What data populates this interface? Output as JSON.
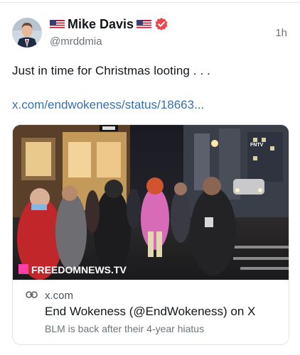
{
  "post": {
    "display_name": "Mike Davis",
    "handle": "@mrddmia",
    "time": "1h",
    "text": "Just in time for Christmas looting . . .",
    "link": "x.com/endwokeness/status/18663..."
  },
  "card": {
    "image_watermark": "FREEDOMNEWS.TV",
    "image_corner_tag": "FNTV",
    "domain": "x.com",
    "title": "End Wokeness (@EndWokeness) on X",
    "description": "BLM is back after their 4-year hiatus"
  },
  "colors": {
    "link": "#3b6fa8",
    "verified_badge": "#e8494f",
    "watermark_accent": "#ff3fa8"
  },
  "icons": [
    "us-flag-icon",
    "verified-badge-icon",
    "link-icon"
  ]
}
